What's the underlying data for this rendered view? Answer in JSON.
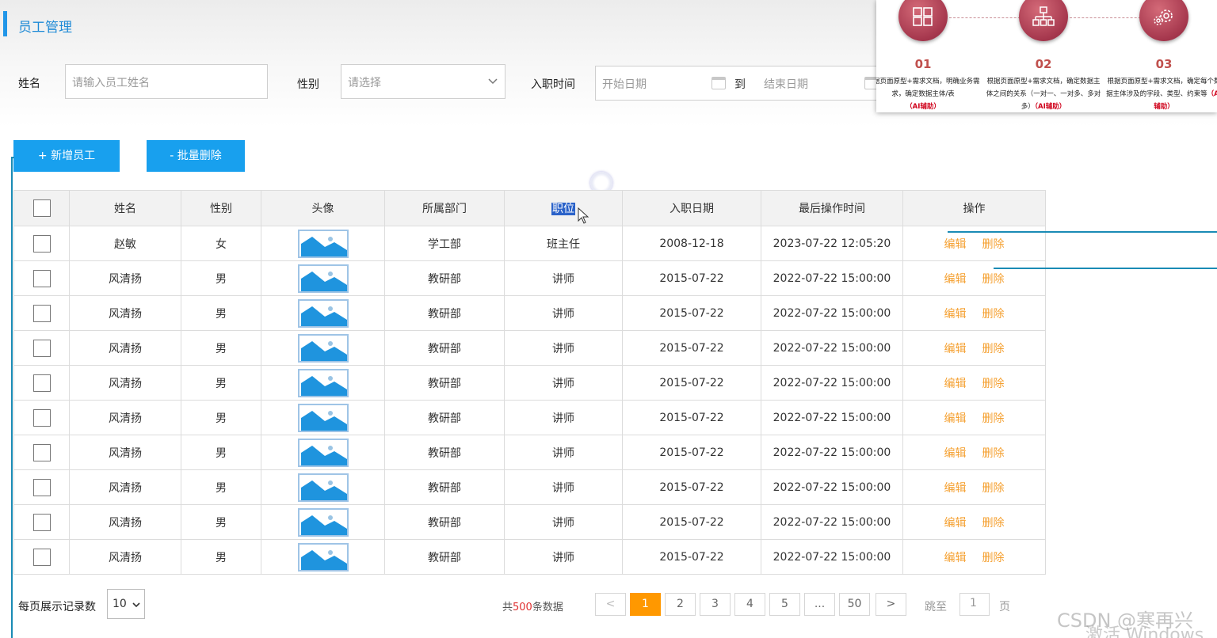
{
  "page": {
    "title": "员工管理"
  },
  "filters": {
    "name_label": "姓名",
    "name_placeholder": "请输入员工姓名",
    "gender_label": "性别",
    "gender_placeholder": "请选择",
    "date_label": "入职时间",
    "start_placeholder": "开始日期",
    "to_label": "到",
    "end_placeholder": "结束日期"
  },
  "workflow": {
    "steps": [
      {
        "num": "01",
        "desc": "根据页面原型+需求文档，明确业务需求，确定数据主体/表",
        "ai": "（AI辅助）",
        "icon": "layout-icon"
      },
      {
        "num": "02",
        "desc": "根据页面原型+需求文档，确定数据主体之间的关系（一对一、一对多、多对多）",
        "ai": "（AI辅助）",
        "icon": "org-chart-icon"
      },
      {
        "num": "03",
        "desc": "根据页面原型+需求文档，确定每个数据主体涉及的字段、类型、约束等",
        "ai": "（AI辅助）",
        "icon": "gears-icon"
      }
    ]
  },
  "actions": {
    "add_label": "+ 新增员工",
    "batch_delete_label": "- 批量删除"
  },
  "table": {
    "columns": [
      "姓名",
      "性别",
      "头像",
      "所属部门",
      "职位",
      "入职日期",
      "最后操作时间",
      "操作"
    ],
    "rows": [
      {
        "name": "赵敏",
        "gender": "女",
        "dept": "学工部",
        "position": "班主任",
        "hire_date": "2008-12-18",
        "last_op": "2023-07-22 12:05:20",
        "edit": "编辑",
        "delete": "删除"
      },
      {
        "name": "风清扬",
        "gender": "男",
        "dept": "教研部",
        "position": "讲师",
        "hire_date": "2015-07-22",
        "last_op": "2022-07-22 15:00:00",
        "edit": "编辑",
        "delete": "删除"
      },
      {
        "name": "风清扬",
        "gender": "男",
        "dept": "教研部",
        "position": "讲师",
        "hire_date": "2015-07-22",
        "last_op": "2022-07-22 15:00:00",
        "edit": "编辑",
        "delete": "删除"
      },
      {
        "name": "风清扬",
        "gender": "男",
        "dept": "教研部",
        "position": "讲师",
        "hire_date": "2015-07-22",
        "last_op": "2022-07-22 15:00:00",
        "edit": "编辑",
        "delete": "删除"
      },
      {
        "name": "风清扬",
        "gender": "男",
        "dept": "教研部",
        "position": "讲师",
        "hire_date": "2015-07-22",
        "last_op": "2022-07-22 15:00:00",
        "edit": "编辑",
        "delete": "删除"
      },
      {
        "name": "风清扬",
        "gender": "男",
        "dept": "教研部",
        "position": "讲师",
        "hire_date": "2015-07-22",
        "last_op": "2022-07-22 15:00:00",
        "edit": "编辑",
        "delete": "删除"
      },
      {
        "name": "风清扬",
        "gender": "男",
        "dept": "教研部",
        "position": "讲师",
        "hire_date": "2015-07-22",
        "last_op": "2022-07-22 15:00:00",
        "edit": "编辑",
        "delete": "删除"
      },
      {
        "name": "风清扬",
        "gender": "男",
        "dept": "教研部",
        "position": "讲师",
        "hire_date": "2015-07-22",
        "last_op": "2022-07-22 15:00:00",
        "edit": "编辑",
        "delete": "删除"
      },
      {
        "name": "风清扬",
        "gender": "男",
        "dept": "教研部",
        "position": "讲师",
        "hire_date": "2015-07-22",
        "last_op": "2022-07-22 15:00:00",
        "edit": "编辑",
        "delete": "删除"
      },
      {
        "name": "风清扬",
        "gender": "男",
        "dept": "教研部",
        "position": "讲师",
        "hire_date": "2015-07-22",
        "last_op": "2022-07-22 15:00:00",
        "edit": "编辑",
        "delete": "删除"
      }
    ]
  },
  "pagination": {
    "page_size_label": "每页展示记录数",
    "page_size": "10",
    "total_prefix": "共",
    "total": "500",
    "total_suffix": "条数据",
    "prev": "<",
    "pages": [
      "1",
      "2",
      "3",
      "4",
      "5",
      "...",
      "50"
    ],
    "current": "1",
    "next": ">",
    "jump_label": "跳至",
    "jump_value": "1",
    "page_unit": "页"
  },
  "watermark": {
    "text": "CSDN @寒再兴",
    "windows": "激活 Windows"
  },
  "colors": {
    "accent": "#18a0ee",
    "title": "#1e8ad6",
    "op": "#f5a030",
    "page_active": "#ff9800",
    "annotation": "#1a8bb5"
  }
}
